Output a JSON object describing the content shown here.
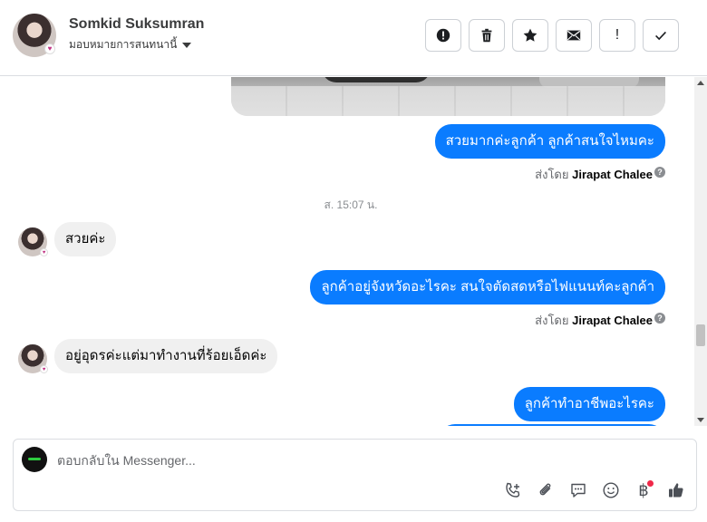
{
  "header": {
    "contact_name": "Somkid Suksumran",
    "assign_label": "มอบหมายการสนทนานี้"
  },
  "actions": [
    {
      "name": "spam-button",
      "icon": "alert-circle-icon"
    },
    {
      "name": "delete-button",
      "icon": "trash-icon"
    },
    {
      "name": "star-button",
      "icon": "star-icon"
    },
    {
      "name": "mark-unread-button",
      "icon": "envelope-icon"
    },
    {
      "name": "follow-up-button",
      "label": "!"
    },
    {
      "name": "mark-done-button",
      "icon": "check-icon"
    }
  ],
  "thread": {
    "messages": {
      "out1": "สวยมากค่ะลูกค้า ลูกค้าสนใจไหมคะ",
      "timestamp": "ส. 15:07 น.",
      "in1": "สวยค่ะ",
      "out2": "ลูกค้าอยู่จังหวัดอะไรคะ  สนใจตัดสดหรือไฟแนนท์คะลูกค้า",
      "in2": "อยู่อุดรค่ะแต่มาทำงานที่ร้อยเอ็ดค่ะ",
      "out3": "ลูกค้าทำอาชีพอะไรคะ"
    },
    "sent_by_prefix": "ส่งโดย",
    "sent_by_name": "Jirapat Chalee",
    "help_mark": "?"
  },
  "composer": {
    "placeholder": "ตอบกลับใน Messenger...",
    "baht_symbol": "฿"
  },
  "colors": {
    "outgoing_bubble": "#0a7cff",
    "incoming_bubble": "#f0f0f0",
    "notification_dot": "#f02849"
  }
}
